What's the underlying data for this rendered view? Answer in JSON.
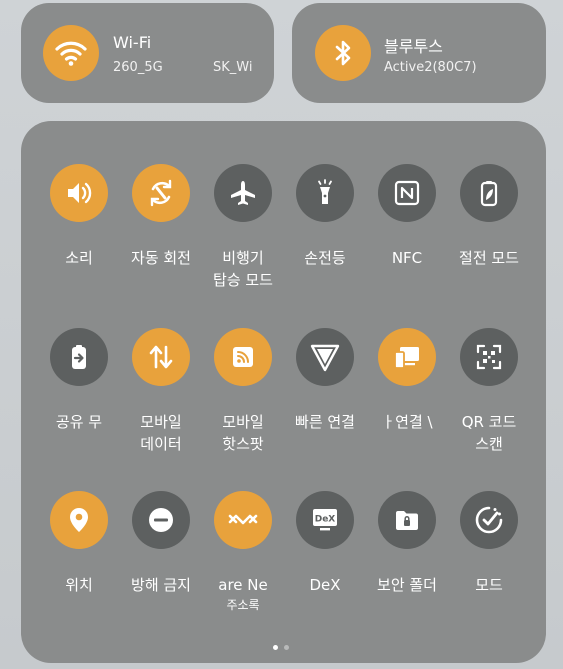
{
  "colors": {
    "active": "#e8a23c",
    "inactive": "#5d6060",
    "panel": "#8a8c8c"
  },
  "wifi": {
    "title": "Wi-Fi",
    "sub_left": "260_5G",
    "sub_right": "SK_Wi",
    "icon": "wifi-icon",
    "state": "on"
  },
  "bluetooth": {
    "title": "블루투스",
    "sub": "Active2(80C7)",
    "icon": "bluetooth-icon",
    "state": "on"
  },
  "tiles": [
    {
      "label": "소리",
      "label2": "",
      "icon": "sound-icon",
      "state": "on"
    },
    {
      "label": "자동 회전",
      "label2": "",
      "icon": "auto-rotate-icon",
      "state": "on"
    },
    {
      "label": "비행기",
      "label2": "탑승 모드",
      "icon": "airplane-icon",
      "state": "off"
    },
    {
      "label": "손전등",
      "label2": "",
      "icon": "flashlight-icon",
      "state": "off"
    },
    {
      "label": "NFC",
      "label2": "",
      "icon": "nfc-icon",
      "state": "off"
    },
    {
      "label": "절전 모드",
      "label2": "",
      "icon": "power-saving-icon",
      "state": "off"
    },
    {
      "label": "공유    무",
      "label2": "",
      "icon": "battery-share-icon",
      "state": "off"
    },
    {
      "label": "모바일",
      "label2": "데이터",
      "icon": "mobile-data-icon",
      "state": "on"
    },
    {
      "label": "모바일",
      "label2": "핫스팟",
      "icon": "hotspot-icon",
      "state": "on"
    },
    {
      "label": "빠른 연결",
      "label2": "",
      "icon": "quick-share-icon",
      "state": "off"
    },
    {
      "label": "ㅏ연결    \\",
      "label2": "",
      "icon": "device-connect-icon",
      "state": "on"
    },
    {
      "label": "QR 코드",
      "label2": "스캔",
      "icon": "qr-scan-icon",
      "state": "off"
    },
    {
      "label": "위치",
      "label2": "",
      "icon": "location-icon",
      "state": "on"
    },
    {
      "label": "방해 금지",
      "label2": "",
      "icon": "do-not-disturb-icon",
      "state": "off"
    },
    {
      "label": "are    Ne",
      "label2": "",
      "sublabel": "주소록",
      "icon": "nearby-share-icon",
      "state": "on"
    },
    {
      "label": "DeX",
      "label2": "",
      "icon": "dex-icon",
      "state": "off"
    },
    {
      "label": "보안 폴더",
      "label2": "",
      "icon": "secure-folder-icon",
      "state": "off"
    },
    {
      "label": "모드",
      "label2": "",
      "icon": "modes-icon",
      "state": "off"
    }
  ],
  "page_indicator": {
    "current": 1,
    "total": 2
  }
}
